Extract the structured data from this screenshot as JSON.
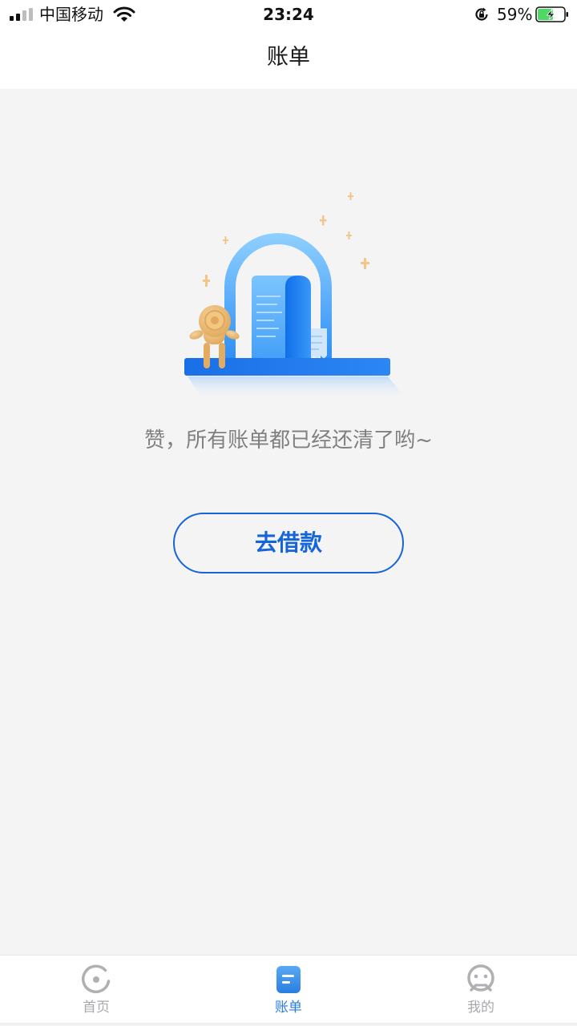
{
  "status_bar": {
    "carrier": "中国移动",
    "time": "23:24",
    "battery_percent": "59%",
    "signal_icon": "cellular-signal-icon",
    "wifi_icon": "wifi-icon",
    "rotation_lock_icon": "rotation-lock-icon",
    "battery_icon": "battery-charging-icon",
    "battery_level": 0.59
  },
  "header": {
    "title": "账单"
  },
  "empty_state": {
    "illustration": "bill-receipt-illustration",
    "message": "赞，所有账单都已经还清了哟~",
    "button_label": "去借款"
  },
  "tab_bar": {
    "tabs": [
      {
        "label": "首页",
        "icon": "home-icon",
        "active": false
      },
      {
        "label": "账单",
        "icon": "bill-icon",
        "active": true
      },
      {
        "label": "我的",
        "icon": "profile-icon",
        "active": false
      }
    ]
  },
  "colors": {
    "accent": "#1565d8",
    "tab_active": "#2a7ee0",
    "tab_inactive": "#a9a9ad",
    "background": "#f4f4f5",
    "battery_fill": "#4cd964",
    "star": "#f5c48a"
  }
}
